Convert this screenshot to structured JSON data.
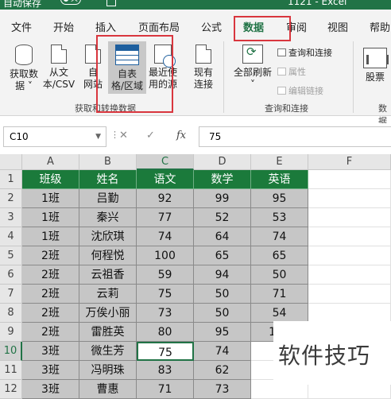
{
  "titlebar": {
    "autosave": "自动保存",
    "toggle_state": "关",
    "title": "1121 - Excel"
  },
  "tabs": [
    {
      "label": "文件",
      "active": false
    },
    {
      "label": "开始",
      "active": false
    },
    {
      "label": "插入",
      "active": false
    },
    {
      "label": "页面布局",
      "active": false
    },
    {
      "label": "公式",
      "active": false
    },
    {
      "label": "数据",
      "active": true
    },
    {
      "label": "审阅",
      "active": false
    },
    {
      "label": "视图",
      "active": false
    },
    {
      "label": "帮助",
      "active": false
    }
  ],
  "ribbon": {
    "get_data": {
      "line1": "获取数",
      "line2": "据 ˅"
    },
    "from_csv": {
      "line1": "从文",
      "line2": "本/CSV"
    },
    "from_web": {
      "line1": "自",
      "line2": "网站"
    },
    "from_table": {
      "line1": "自表",
      "line2": "格/区域"
    },
    "recent_sources": {
      "line1": "最近使",
      "line2": "用的源"
    },
    "existing_conn": {
      "line1": "现有",
      "line2": "连接"
    },
    "group1_label": "获取和转换数据",
    "refresh_all": {
      "line1": "全部刷新",
      "line2": "˅"
    },
    "queries_conn": "查询和连接",
    "properties": "属性",
    "edit_links": "编辑链接",
    "group2_label": "查询和连接",
    "stocks": "股票",
    "group3_label": "数据"
  },
  "formula_bar": {
    "name_box": "C10",
    "fx": "fx",
    "value": "75"
  },
  "grid": {
    "columns": [
      "A",
      "B",
      "C",
      "D",
      "E",
      "F"
    ],
    "rows": [
      "1",
      "2",
      "3",
      "4",
      "5",
      "6",
      "7",
      "8",
      "9",
      "10",
      "11",
      "12"
    ],
    "header": [
      "班级",
      "姓名",
      "语文",
      "数学",
      "英语"
    ],
    "data": [
      [
        "1班",
        "吕勤",
        "92",
        "99",
        "95"
      ],
      [
        "1班",
        "秦兴",
        "77",
        "52",
        "53"
      ],
      [
        "1班",
        "沈欣琪",
        "74",
        "64",
        "74"
      ],
      [
        "2班",
        "何程悦",
        "100",
        "65",
        "65"
      ],
      [
        "2班",
        "云祖香",
        "59",
        "94",
        "50"
      ],
      [
        "2班",
        "云莉",
        "75",
        "50",
        "71"
      ],
      [
        "2班",
        "万俟小丽",
        "73",
        "50",
        "54"
      ],
      [
        "2班",
        "雷胜英",
        "80",
        "95",
        "100"
      ],
      [
        "3班",
        "微生芳",
        "75",
        "74",
        ""
      ],
      [
        "3班",
        "冯明珠",
        "83",
        "62",
        ""
      ],
      [
        "3班",
        "曹惠",
        "71",
        "73",
        ""
      ]
    ]
  },
  "watermark": "软件技巧",
  "colors": {
    "excel_green": "#217346",
    "highlight_red": "#d9363e",
    "header_fill": "#1b7a3b"
  }
}
